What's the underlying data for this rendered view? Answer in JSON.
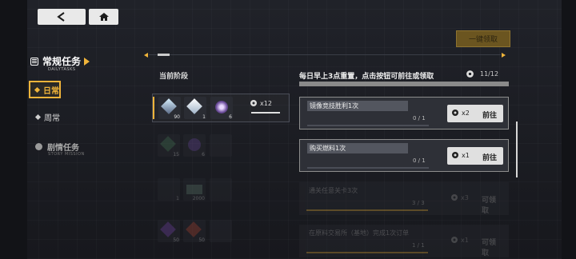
{
  "nav": {
    "back_icon": "back-arrow-icon",
    "home_icon": "home-icon",
    "claim_all_label": "一键领取"
  },
  "sidebar": {
    "category_title": "常规任务",
    "category_subtitle": "DAILYTASKS",
    "items": [
      {
        "label": "日常",
        "selected": true
      },
      {
        "label": "周常",
        "selected": false
      }
    ],
    "story": {
      "label": "剧情任务",
      "subtitle": "STORY MISSION"
    }
  },
  "stage_panel": {
    "title": "当前阶段",
    "rows": [
      {
        "items": [
          {
            "icon": "crystal-icon",
            "count": "90"
          },
          {
            "icon": "cube-icon",
            "count": "1"
          },
          {
            "icon": "lens-orb-icon",
            "count": "6"
          }
        ],
        "total": "x12"
      },
      {
        "items": [
          {
            "icon": "green-crate-icon",
            "count": "15"
          },
          {
            "icon": "lens-orb-icon",
            "count": "6"
          },
          {
            "icon": "empty-slot-icon",
            "count": ""
          }
        ]
      },
      {
        "items": [
          {
            "icon": "empty-slot-icon",
            "count": "1"
          },
          {
            "icon": "card-icon",
            "count": "2000"
          },
          {
            "icon": "empty-slot-icon",
            "count": ""
          }
        ]
      },
      {
        "items": [
          {
            "icon": "purple-crystal-icon",
            "count": "50"
          },
          {
            "icon": "red-ore-icon",
            "count": "50"
          },
          {
            "icon": "empty-slot-icon",
            "count": ""
          }
        ]
      }
    ]
  },
  "tasks_panel": {
    "header": "每日早上3点重置，点击按钮可前往或领取",
    "progress": "11/12",
    "tasks": [
      {
        "name": "镜像竞技胜利1次",
        "count": "0 / 1",
        "reward": "x2",
        "action": "前往",
        "progress": 0
      },
      {
        "name": "购买燃料1次",
        "count": "0 / 1",
        "reward": "x1",
        "action": "前往",
        "progress": 0
      },
      {
        "name": "通关任意关卡3次",
        "count": "3 / 3",
        "reward": "x3",
        "action": "可领取",
        "progress": 1
      },
      {
        "name": "在原料交易所（基地）完成1次订单",
        "count": "1 / 1",
        "reward": "x1",
        "action": "可领取",
        "progress": 1
      }
    ]
  },
  "colors": {
    "accent": "#f0b43a",
    "background": "#1a1c22"
  }
}
